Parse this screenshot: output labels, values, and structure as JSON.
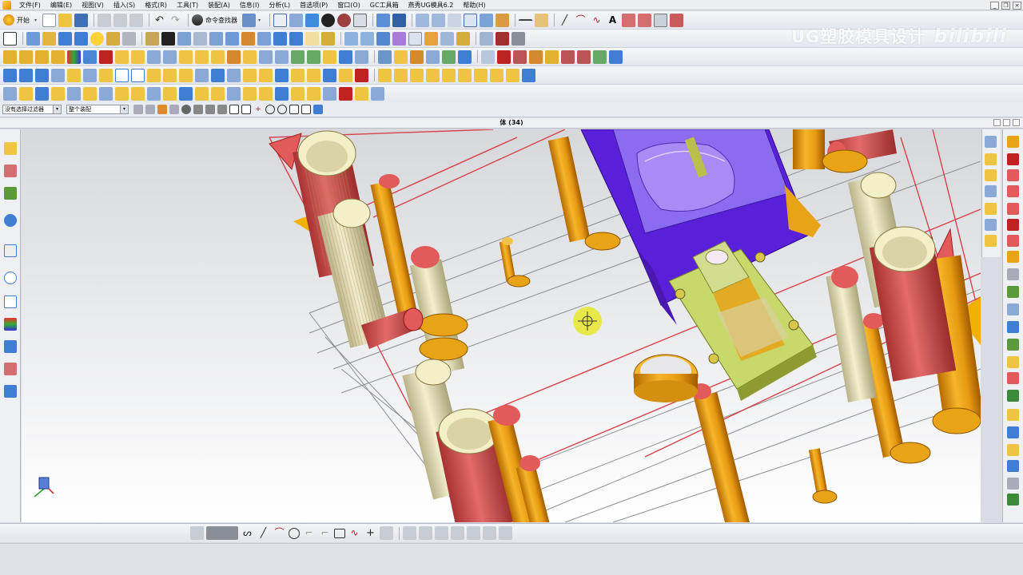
{
  "menubar": {
    "items": [
      "文件(F)",
      "编辑(E)",
      "视图(V)",
      "插入(S)",
      "格式(R)",
      "工具(T)",
      "装配(A)",
      "信息(I)",
      "分析(L)",
      "首选项(P)",
      "窗口(O)",
      "GC工具箱",
      "燕秀UG模具6.2",
      "帮助(H)"
    ]
  },
  "toolbar": {
    "start_label": "开始",
    "command_finder_label": "命令查找器"
  },
  "watermark": {
    "text": "UG塑胶模具设计",
    "logo": "bilibili"
  },
  "selection_bar": {
    "filter_value": "没有选择过滤器",
    "scope_value": "整个装配"
  },
  "viewport": {
    "title": "体 (34)"
  },
  "colors": {
    "orange": "#e8a317",
    "red": "#d9534f",
    "purple": "#6a22e0",
    "olive": "#b5c14a",
    "cream": "#f2eec4",
    "cursor": "#e9e84a"
  }
}
